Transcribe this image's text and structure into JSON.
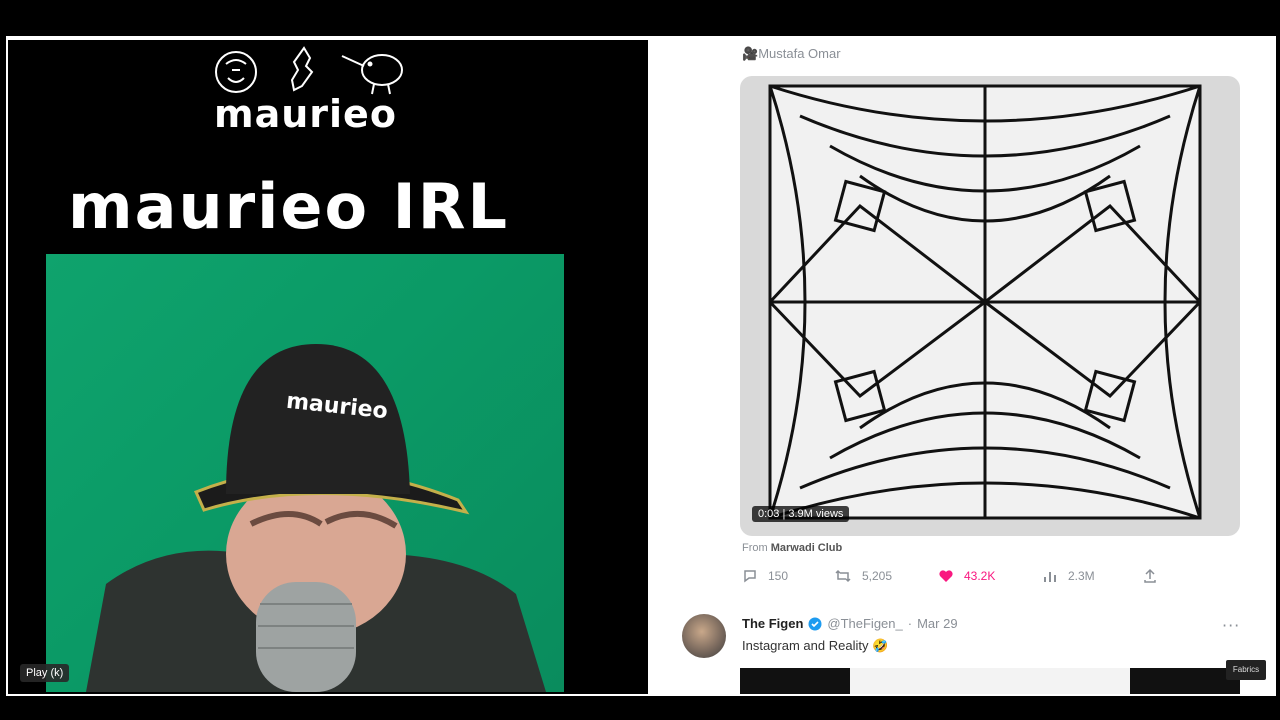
{
  "left_panel": {
    "logo_text": "maurieo",
    "title": "maurieo IRL",
    "hat_text": "maurieo",
    "play_label": "Play (k)"
  },
  "tweet": {
    "author": "Mustafa Omar",
    "video_info": "0:03 | 3.9M views",
    "from_prefix": "From",
    "from_source": "Marwadi Club",
    "stats": {
      "replies": "150",
      "retweets": "5,205",
      "likes": "43.2K",
      "views": "2.3M"
    }
  },
  "reply": {
    "name": "The Figen",
    "handle": "@TheFigen_",
    "date": "Mar 29",
    "text": "Instagram and Reality 🤣"
  },
  "brand_text": "Fabrics",
  "colors": {
    "green_screen": "#0fa36d",
    "like_pink": "#f91880",
    "verified_blue": "#1d9bf0"
  }
}
